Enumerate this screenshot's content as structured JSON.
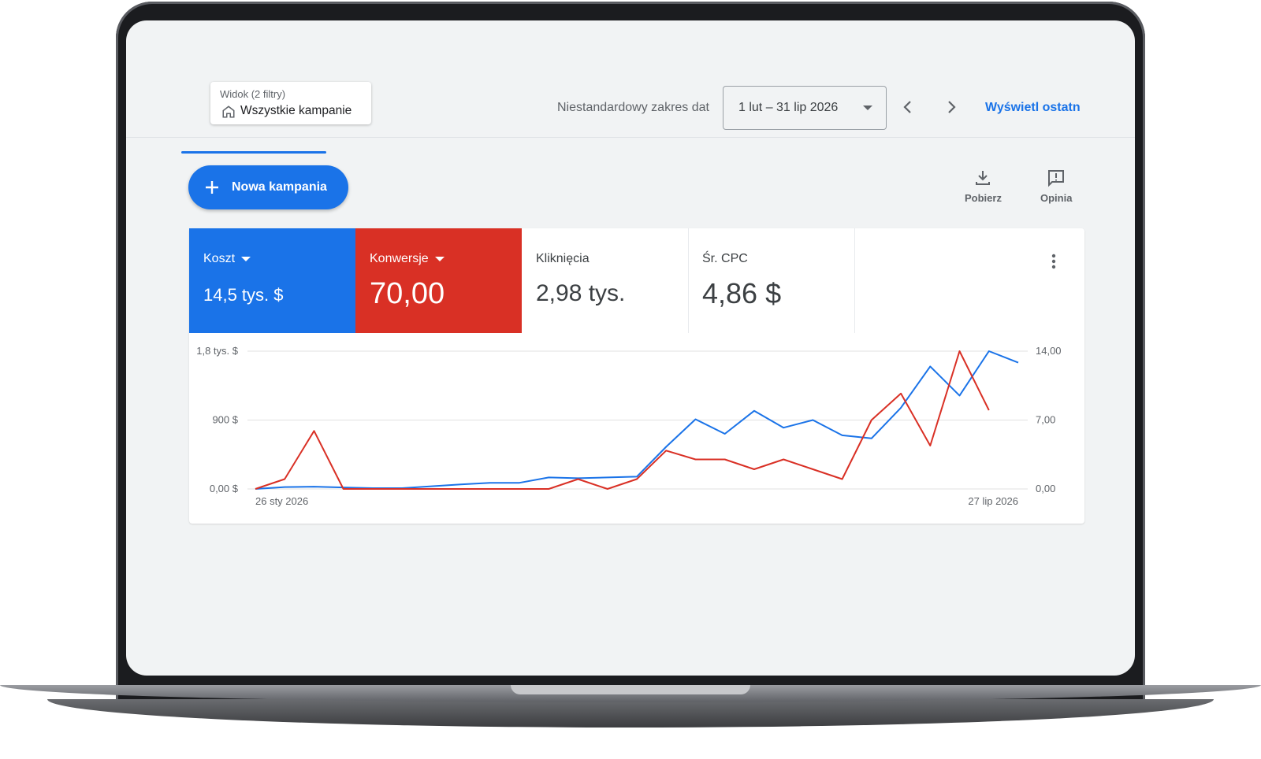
{
  "toolbar": {
    "view_subtitle": "Widok (2 filtry)",
    "view_title": "Wszystkie kampanie",
    "date_label": "Niestandardowy zakres dat",
    "date_value": "1 lut – 31 lip 2026",
    "view_last_label": "Wyświetl ostatn",
    "home_icon": "home-icon",
    "prev_icon": "chevron-left-icon",
    "next_icon": "chevron-right-icon"
  },
  "actions": {
    "new_campaign_label": "Nowa kampania",
    "download_label": "Pobierz",
    "feedback_label": "Opinia"
  },
  "metrics": [
    {
      "name": "Koszt",
      "value": "14,5 tys. $",
      "color": "#1a73e8",
      "has_dropdown": true
    },
    {
      "name": "Konwersje",
      "value": "70,00",
      "color": "#d93025",
      "has_dropdown": true
    },
    {
      "name": "Kliknięcia",
      "value": "2,98 tys.",
      "has_dropdown": false
    },
    {
      "name": "Śr. CPC",
      "value": "4,86 $",
      "has_dropdown": false
    }
  ],
  "colors": {
    "accent": "#1a73e8",
    "conversion": "#d93025"
  },
  "chart_data": {
    "type": "line",
    "x_start_label": "26 sty 2026",
    "x_end_label": "27 lip 2026",
    "left_axis": {
      "ticks": [
        "0,00 $",
        "900 $",
        "1,8 tys. $"
      ],
      "ylim": [
        0,
        1800
      ]
    },
    "right_axis": {
      "ticks": [
        "0,00",
        "7,00",
        "14,00"
      ],
      "ylim": [
        0,
        14
      ]
    },
    "grid": true,
    "series": [
      {
        "name": "Koszt",
        "axis": "left",
        "color": "#1a73e8",
        "values": [
          0,
          25,
          30,
          20,
          10,
          10,
          35,
          60,
          80,
          80,
          150,
          140,
          150,
          160,
          550,
          910,
          720,
          1020,
          800,
          900,
          700,
          660,
          1060,
          1600,
          1220,
          1800,
          1650
        ]
      },
      {
        "name": "Konwersje",
        "axis": "right",
        "color": "#d93025",
        "values": [
          0,
          1,
          5.9,
          0,
          0,
          0,
          0,
          0,
          0,
          0,
          0,
          1,
          0,
          1,
          3.9,
          3,
          3,
          2,
          3,
          2,
          1,
          7,
          9.7,
          4.4,
          14,
          8
        ]
      }
    ]
  }
}
